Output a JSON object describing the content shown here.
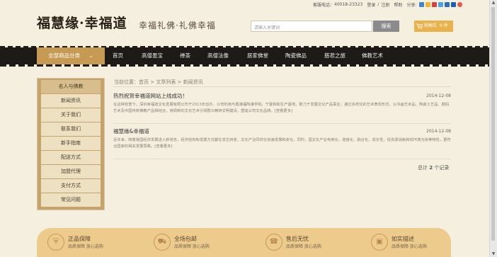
{
  "topbar": {
    "hotline_label": "客服电话：",
    "hotline": "40018-23323",
    "login": "登录",
    "sep": "/",
    "register": "注册",
    "help": "帮助",
    "share": "分享:"
  },
  "header": {
    "logo": "福慧缘·幸福道",
    "slogan": "幸福礼佛·礼佛幸福",
    "search_placeholder": "请输入关键词",
    "search_button": "搜索",
    "cart_label": "购物车",
    "cart_count": "0",
    "cart_unit": "件"
  },
  "nav": {
    "all_label": "全部商品分类",
    "items": [
      "首页",
      "高僧墨宝",
      "禅茶",
      "高僧法像",
      "居家佛堂",
      "陶瓷佛品",
      "慈悲之旅",
      "佛教艺术"
    ]
  },
  "sidebar": {
    "items": [
      "名人与佛教",
      "新闻资讯",
      "关于我们",
      "联系我们",
      "新手指南",
      "配送方式",
      "加盟代理",
      "支付方式",
      "常见问题"
    ]
  },
  "breadcrumb": {
    "prefix": "当前位置：",
    "home": "首页",
    "sep": ">",
    "list": "文章列表",
    "current": "新闻资讯"
  },
  "articles": [
    {
      "title": "热烈祝贺幸福道网站上线成功！",
      "date": "2014-12-08",
      "body": "在这种背景下，深圳幸福道文化发展有限公司于2013年创办，公司利用与香港福陶港学院，宁夏和和生产基地，致力于发展文化产品事业；通过多样化的艺术表现形式，以书画艺术品、陶瓷工艺品、数码艺术及中国传统佛教产品相结合，用周到的文化艺术引领群众精神文明建设，塑造公司文化品牌。[查看更多]"
    },
    {
      "title": "福慧缘&幸福道",
      "date": "2014-12-08",
      "body": "近年来，随着我国经济发展进入新常态，经济结构和发展方式都在发生转变，文化产业同样在快速发展和变化，同时，国文化产业电商化，增值化，融合化，成长性，低资源消耗和低环境污染等特性，更符合国家的相关发展思路。[查看更多]"
    }
  ],
  "pagination": {
    "prefix": "总计",
    "count": "2",
    "suffix": "个记录"
  },
  "services": [
    {
      "title": "正品保障",
      "sub": "品质保障 放心选购",
      "icon": "shield-icon"
    },
    {
      "title": "全场包邮",
      "sub": "品质保障 放心选购",
      "icon": "truck-icon"
    },
    {
      "title": "售后无忧",
      "sub": "品质保障 放心选购",
      "icon": "headset-icon"
    },
    {
      "title": "如实描述",
      "sub": "品质保障 放心选购",
      "icon": "image-icon"
    }
  ],
  "colors": {
    "nav_bg": "#1d1a17",
    "accent_gold": "#c79a53",
    "cart_orange": "#e9b24a",
    "service_band": "#eccb8d"
  }
}
